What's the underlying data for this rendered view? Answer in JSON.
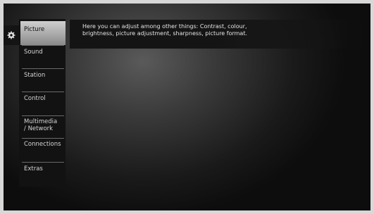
{
  "menu": {
    "icon": "gear-icon",
    "items": [
      {
        "label": "Picture"
      },
      {
        "label": "Sound"
      },
      {
        "label": "Station"
      },
      {
        "label": "Control"
      },
      {
        "label": "Multimedia / Network",
        "line1": "Multimedia",
        "line2": "/ Network"
      },
      {
        "label": "Connections"
      },
      {
        "label": "Extras"
      }
    ],
    "selected": "Picture"
  },
  "description": {
    "line1": "Here you can adjust among other things: Contrast, colour,",
    "line2": "brightness, picture adjustment, sharpness, picture format."
  }
}
